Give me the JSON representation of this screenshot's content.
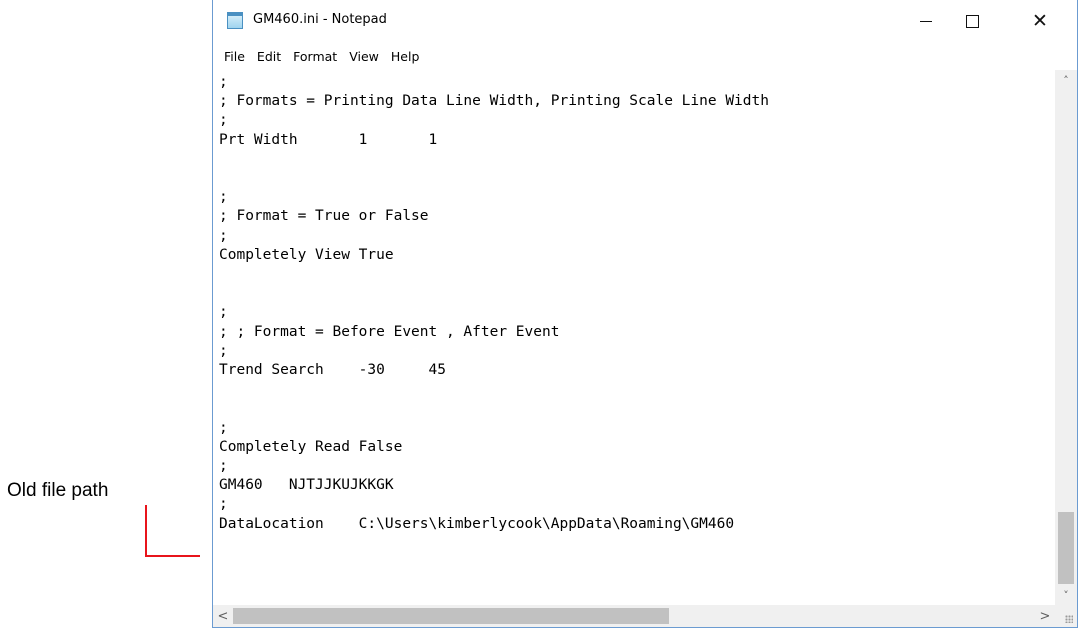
{
  "annotation": {
    "label": "Old file path"
  },
  "window": {
    "title": "GM460.ini - Notepad",
    "icon": "notepad-icon",
    "controls": {
      "minimize": "minimize-icon",
      "maximize": "maximize-icon",
      "close": "close-icon"
    }
  },
  "menu": {
    "items": [
      {
        "label": "File"
      },
      {
        "label": "Edit"
      },
      {
        "label": "Format"
      },
      {
        "label": "View"
      },
      {
        "label": "Help"
      }
    ]
  },
  "editor": {
    "content": ";\n; Formats = Printing Data Line Width, Printing Scale Line Width\n;\nPrt Width       1       1\n\n\n;\n; Format = True or False\n;\nCompletely View True\n\n\n;\n; ; Format = Before Event , After Event\n;\nTrend Search    -30     45\n\n\n;\nCompletely Read False\n;\nGM460   NJTJJKUJKKGK\n;\nDataLocation    C:\\Users\\kimberlycook\\AppData\\Roaming\\GM460"
  },
  "scrollbars": {
    "vertical": {
      "up": "˄",
      "down": "˅"
    },
    "horizontal": {
      "left": "<",
      "right": ">"
    }
  },
  "colors": {
    "callout": "#e8141b",
    "window_border": "#6b9bd1"
  }
}
